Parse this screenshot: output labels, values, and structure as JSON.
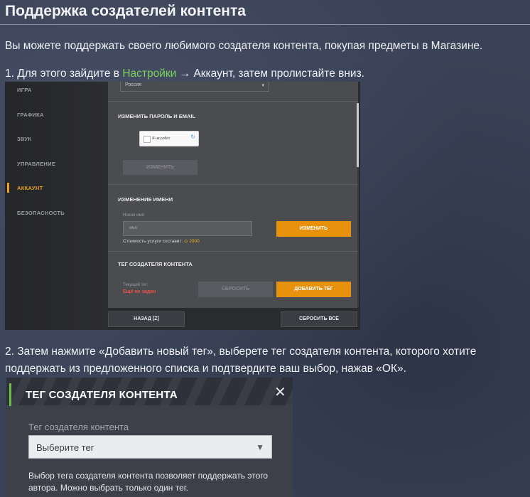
{
  "page": {
    "title": "Поддержка создателей контента",
    "intro": "Вы можете поддержать своего любимого создателя контента, покупая предметы в Магазине.",
    "step1_prefix": "1. Для этого зайдите в ",
    "step1_link": "Настройки",
    "step1_suffix": " → Аккаунт, затем пролистайте вниз.",
    "step2": "2. Затем нажмите «Добавить новый тег», выберете тег создателя контента, которого хотите поддержать из предложенного списка и подтвердите ваш выбор, нажав «ОК»."
  },
  "settings": {
    "sidebar": [
      "ИГРА",
      "ГРАФИКА",
      "ЗВУК",
      "УПРАВЛЕНИЕ",
      "АККАУНТ",
      "БЕЗОПАСНОСТЬ"
    ],
    "country_value": "Россия",
    "change_password_title": "ИЗМЕНИТЬ ПАРОЛЬ И EMAIL",
    "captcha_label": "Я не робот",
    "change_button": "ИЗМЕНИТЬ",
    "name_change_title": "ИЗМЕНЕНИЕ ИМЕНИ",
    "new_name_label": "Новое имя",
    "name_placeholder": "имя",
    "change_name_button": "ИЗМЕНИТЬ",
    "cost_label": "Стоимость услуги составит:",
    "cost_value": "2000",
    "creator_tag_title": "ТЕГ СОЗДАТЕЛЯ КОНТЕНТА",
    "current_tag_label": "Текущий тег:",
    "current_tag_value": "Ещё не задан",
    "reset_button": "СБРОСИТЬ",
    "add_tag_button": "ДОБАВИТЬ ТЕГ",
    "back_button": "НАЗАД [Z]",
    "reset_all_button": "СБРОСИТЬ ВСЕ"
  },
  "dialog": {
    "title": "ТЕГ СОЗДАТЕЛЯ КОНТЕНТА",
    "field_label": "Тег создателя контента",
    "select_value": "Выберите тег",
    "description": "Выбор тега создателя контента позволяет поддержать этого автора. Можно выбрать только один тег."
  },
  "colors": {
    "accent_green": "#7dd25a",
    "orange": "#e8910c",
    "active": "#e8a317",
    "error": "#e8524a"
  },
  "icons": {
    "close": "close-icon",
    "dropdown": "chevron-down-icon",
    "coin": "coin-icon"
  }
}
